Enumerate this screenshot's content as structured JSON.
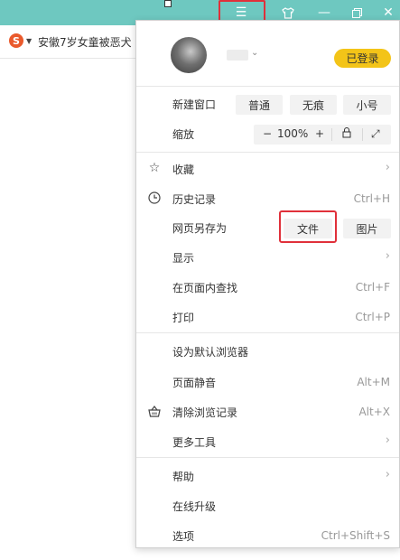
{
  "titlebar": {
    "color": "#6ec8c0",
    "highlight_color": "#e0303a",
    "icons": [
      "menu-icon",
      "skin-icon",
      "minimize-icon",
      "maximize-icon",
      "close-icon"
    ]
  },
  "toolbar": {
    "search_engine_icon": "S",
    "news_text": "安徽7岁女童被恶犬"
  },
  "menu": {
    "login_label": "已登录",
    "login_color": "#f3c418",
    "new_window": {
      "label": "新建窗口",
      "normal": "普通",
      "incognito": "无痕",
      "small": "小号"
    },
    "zoom": {
      "label": "缩放",
      "minus": "−",
      "value": "100%",
      "plus": "+"
    },
    "items": {
      "favorites": "收藏",
      "history": "历史记录",
      "history_shortcut": "Ctrl+H",
      "save_as": "网页另存为",
      "save_file": "文件",
      "save_image": "图片",
      "display": "显示",
      "find": "在页面内查找",
      "find_shortcut": "Ctrl+F",
      "print": "打印",
      "print_shortcut": "Ctrl+P",
      "default_browser": "设为默认浏览器",
      "mute": "页面静音",
      "mute_shortcut": "Alt+M",
      "clear": "清除浏览记录",
      "clear_shortcut": "Alt+X",
      "more_tools": "更多工具",
      "help": "帮助",
      "upgrade": "在线升级",
      "options": "选项",
      "options_shortcut": "Ctrl+Shift+S"
    }
  }
}
